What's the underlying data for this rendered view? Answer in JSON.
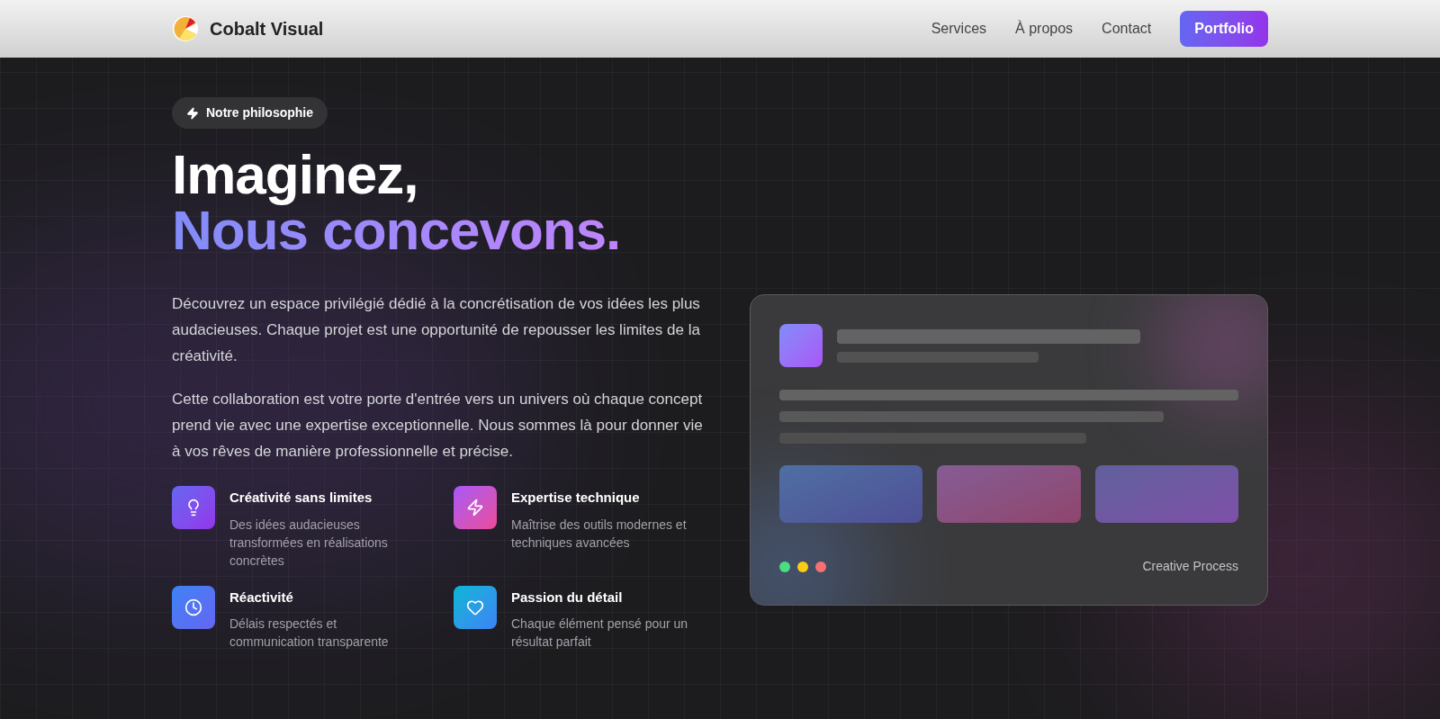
{
  "header": {
    "brand": "Cobalt Visual",
    "nav": [
      "Services",
      "À propos",
      "Contact"
    ],
    "cta": "Portfolio"
  },
  "hero": {
    "badge": "Notre philosophie",
    "title_line1": "Imaginez,",
    "title_line2": "Nous concevons.",
    "paragraphs": [
      "Découvrez un espace privilégié dédié à la concrétisation de vos idées les plus audacieuses. Chaque projet est une opportunité de repousser les limites de la créativité.",
      "Cette collaboration est votre porte d'entrée vers un univers où chaque concept prend vie avec une expertise exceptionnelle. Nous sommes là pour donner vie à vos rêves de manière professionnelle et précise."
    ],
    "features": [
      {
        "kind": "idea",
        "title": "Créativité sans limites",
        "text": "Des idées audacieuses transformées en réalisations concrètes"
      },
      {
        "kind": "expertise",
        "title": "Expertise technique",
        "text": "Maîtrise des outils modernes et techniques avancées"
      },
      {
        "kind": "speed",
        "title": "Réactivité",
        "text": "Délais respectés et communication transparente"
      },
      {
        "kind": "care",
        "title": "Passion du détail",
        "text": "Chaque élément pensé pour un résultat parfait"
      }
    ]
  },
  "preview_card": {
    "dots": [
      {
        "color": "#4ade80"
      },
      {
        "color": "#facc15"
      },
      {
        "color": "#f87171"
      }
    ],
    "caption": "Creative Process"
  }
}
